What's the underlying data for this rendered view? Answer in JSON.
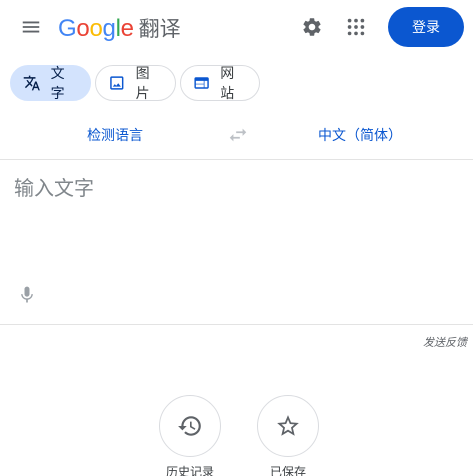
{
  "header": {
    "logo_letters": [
      {
        "ch": "G",
        "color": "#4285F4"
      },
      {
        "ch": "o",
        "color": "#EA4335"
      },
      {
        "ch": "o",
        "color": "#FBBC05"
      },
      {
        "ch": "g",
        "color": "#4285F4"
      },
      {
        "ch": "l",
        "color": "#34A853"
      },
      {
        "ch": "e",
        "color": "#EA4335"
      }
    ],
    "product": "翻译",
    "signin_label": "登录",
    "menu_icon": "hamburger-menu-icon",
    "settings_icon": "gear-icon",
    "apps_icon": "apps-grid-icon"
  },
  "modes": [
    {
      "label": "文字",
      "icon": "translate-icon",
      "active": true
    },
    {
      "label": "图片",
      "icon": "image-icon",
      "active": false
    },
    {
      "label": "网站",
      "icon": "website-icon",
      "active": false
    }
  ],
  "languages": {
    "source": "检测语言",
    "target": "中文（简体）",
    "swap_icon": "swap-arrows-icon"
  },
  "input": {
    "placeholder": "输入文字",
    "value": "",
    "mic_icon": "microphone-icon"
  },
  "feedback_label": "发送反馈",
  "actions": [
    {
      "label": "历史记录",
      "icon": "history-icon"
    },
    {
      "label": "已保存",
      "icon": "star-icon"
    }
  ],
  "colors": {
    "accent": "#0b57d0",
    "active_chip": "#d3e3fd"
  }
}
